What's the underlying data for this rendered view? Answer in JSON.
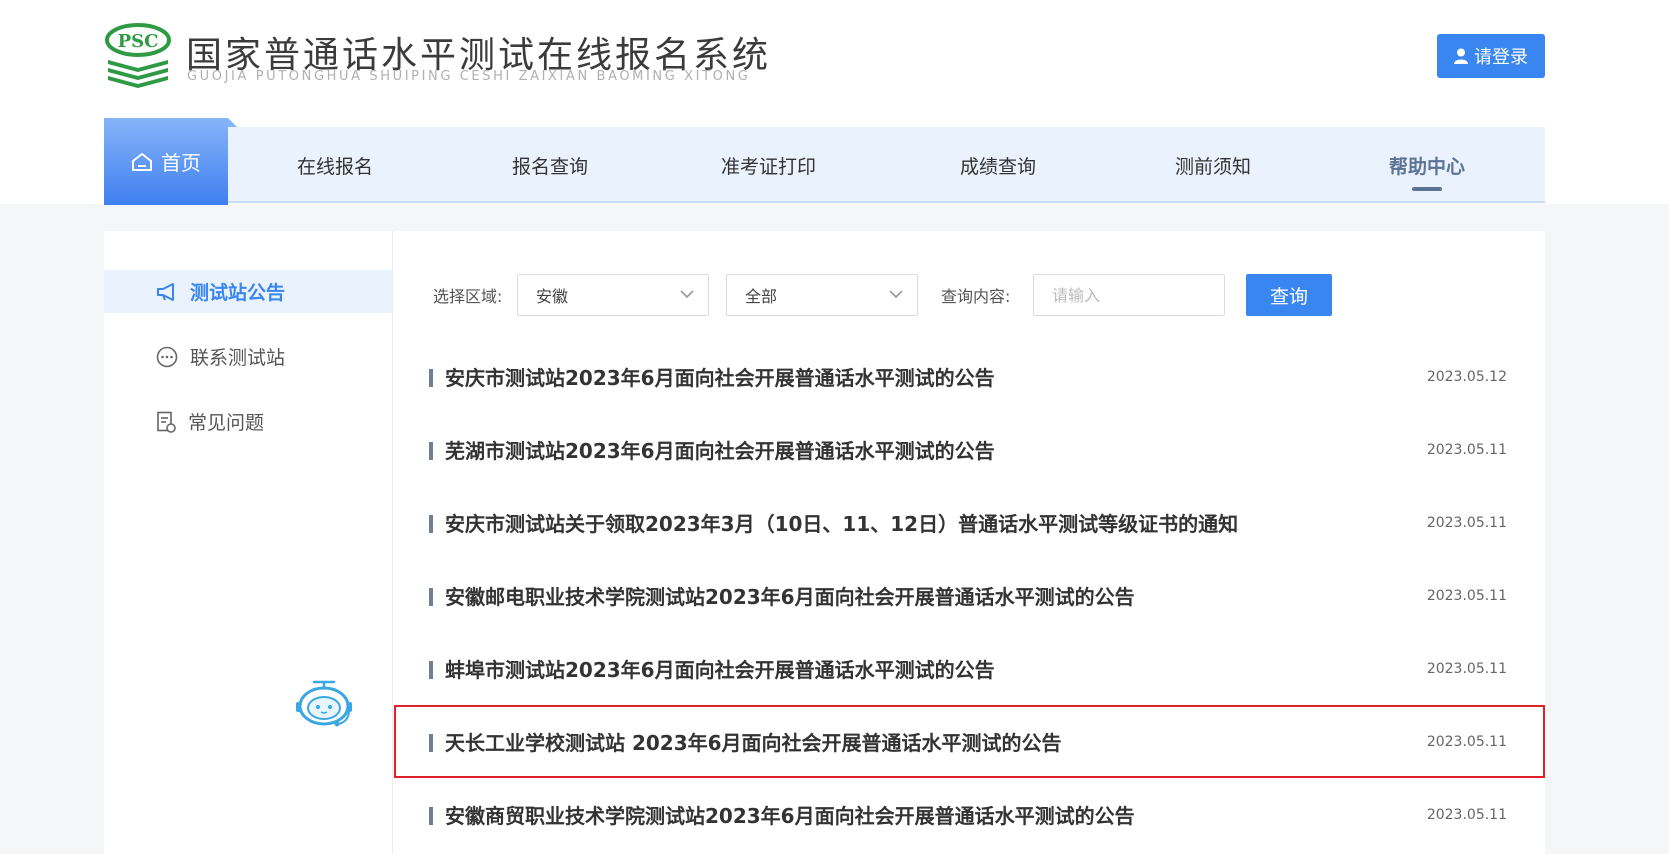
{
  "header": {
    "logo_text": "PSC",
    "title": "国家普通话水平测试在线报名系统",
    "subtitle": "GUOJIA PUTONGHUA SHUIPING CESHI ZAIXIAN BAOMING XITONG",
    "login_label": "请登录"
  },
  "nav": {
    "home_label": "首页",
    "items": [
      {
        "label": "在线报名"
      },
      {
        "label": "报名查询"
      },
      {
        "label": "准考证打印"
      },
      {
        "label": "成绩查询"
      },
      {
        "label": "测前须知"
      },
      {
        "label": "帮助中心",
        "active": true
      }
    ]
  },
  "sidebar": {
    "items": [
      {
        "label": "测试站公告",
        "icon": "megaphone-icon",
        "active": true
      },
      {
        "label": "联系测试站",
        "icon": "chat-icon"
      },
      {
        "label": "常见问题",
        "icon": "faq-document-icon"
      }
    ]
  },
  "filters": {
    "region_label": "选择区域:",
    "region_value": "安徽",
    "category_value": "全部",
    "query_label": "查询内容:",
    "query_placeholder": "请输入",
    "query_value": "",
    "search_label": "查询"
  },
  "announcements": [
    {
      "title": "安庆市测试站2023年6月面向社会开展普通话水平测试的公告",
      "date": "2023.05.12"
    },
    {
      "title": "芜湖市测试站2023年6月面向社会开展普通话水平测试的公告",
      "date": "2023.05.11"
    },
    {
      "title": "安庆市测试站关于领取2023年3月（10日、11、12日）普通话水平测试等级证书的通知",
      "date": "2023.05.11"
    },
    {
      "title": "安徽邮电职业技术学院测试站2023年6月面向社会开展普通话水平测试的公告",
      "date": "2023.05.11"
    },
    {
      "title": "蚌埠市测试站2023年6月面向社会开展普通话水平测试的公告",
      "date": "2023.05.11"
    },
    {
      "title": "天长工业学校测试站 2023年6月面向社会开展普通话水平测试的公告",
      "date": "2023.05.11",
      "highlighted": true
    },
    {
      "title": "安徽商贸职业技术学院测试站2023年6月面向社会开展普通话水平测试的公告",
      "date": "2023.05.11"
    }
  ],
  "colors": {
    "accent": "#3a86f0",
    "nav_bg": "#eaf2fd",
    "highlight_border": "#e0202a",
    "logo_green": "#2e9a44"
  }
}
